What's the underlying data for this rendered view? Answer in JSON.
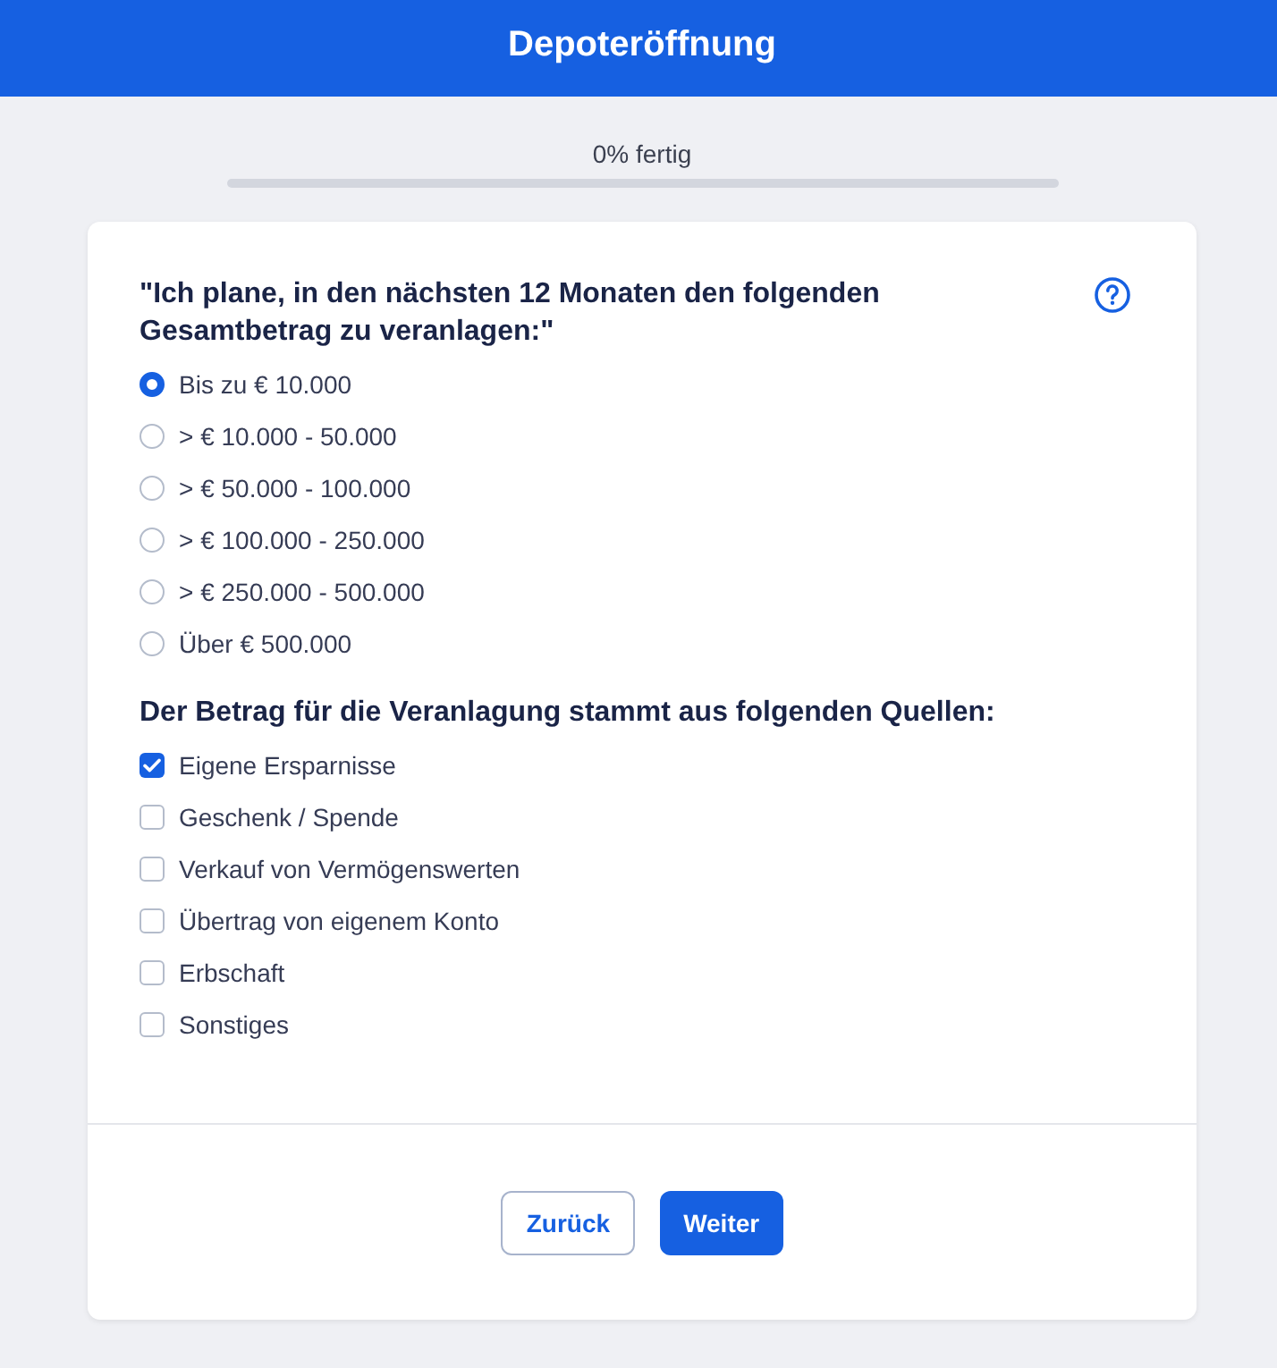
{
  "header": {
    "title": "Depoteröffnung"
  },
  "progress": {
    "label": "0% fertig"
  },
  "question": {
    "text": "\"Ich plane, in den nächsten 12 Monaten den folgenden Gesamtbetrag zu veranlagen:\"",
    "options": [
      {
        "label": "Bis zu € 10.000",
        "selected": true
      },
      {
        "label": "> € 10.000 - 50.000",
        "selected": false
      },
      {
        "label": "> € 50.000 - 100.000",
        "selected": false
      },
      {
        "label": "> € 100.000 - 250.000",
        "selected": false
      },
      {
        "label": "> € 250.000 - 500.000",
        "selected": false
      },
      {
        "label": "Über € 500.000",
        "selected": false
      }
    ]
  },
  "sources": {
    "heading": "Der Betrag für die Veranlagung stammt aus folgenden Quellen:",
    "options": [
      {
        "label": "Eigene Ersparnisse",
        "checked": true
      },
      {
        "label": "Geschenk / Spende",
        "checked": false
      },
      {
        "label": "Verkauf von Vermögenswerten",
        "checked": false
      },
      {
        "label": "Übertrag von eigenem Konto",
        "checked": false
      },
      {
        "label": "Erbschaft",
        "checked": false
      },
      {
        "label": "Sonstiges",
        "checked": false
      }
    ]
  },
  "buttons": [
    {
      "label": "Zurück",
      "kind": "secondary"
    },
    {
      "label": "Weiter",
      "kind": "primary"
    }
  ]
}
